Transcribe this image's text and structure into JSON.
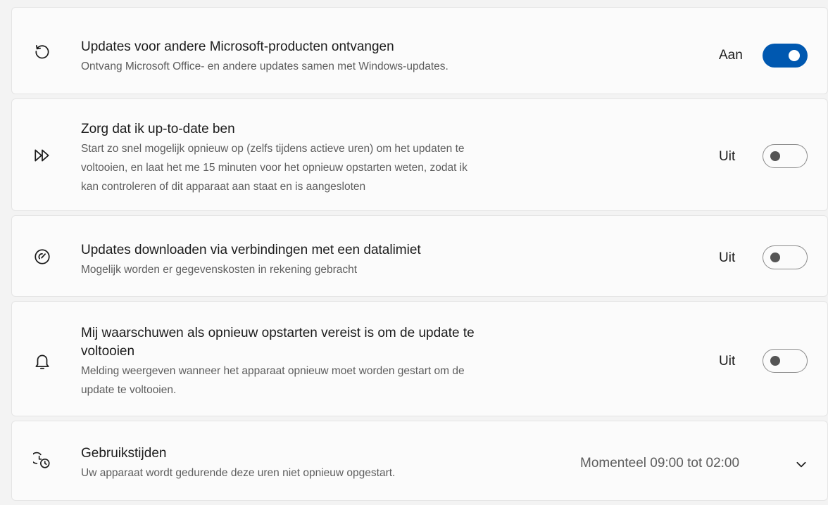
{
  "settings": [
    {
      "icon": "refresh-icon",
      "title": "Updates voor andere Microsoft-producten ontvangen",
      "description": [
        "Ontvang Microsoft Office- en andere updates samen met Windows-updates."
      ],
      "state_label": "Aan",
      "enabled": true
    },
    {
      "icon": "fast-forward-icon",
      "title": "Zorg dat ik up-to-date ben",
      "description": [
        "Start zo snel mogelijk opnieuw op (zelfs tijdens actieve uren) om het updaten te",
        "voltooien, en laat het me 15 minuten voor het opnieuw opstarten weten, zodat ik",
        "kan controleren of dit apparaat aan staat en is aangesloten"
      ],
      "state_label": "Uit",
      "enabled": false
    },
    {
      "icon": "speedometer-icon",
      "title": "Updates downloaden via verbindingen met een datalimiet",
      "description": [
        "Mogelijk worden er gegevenskosten in rekening gebracht"
      ],
      "state_label": "Uit",
      "enabled": false
    },
    {
      "icon": "bell-icon",
      "title": [
        "Mij waarschuwen als opnieuw opstarten vereist is om de update te",
        "voltooien"
      ],
      "description": [
        "Melding weergeven wanneer het apparaat opnieuw moet worden gestart om de",
        "update te voltooien."
      ],
      "state_label": "Uit",
      "enabled": false
    },
    {
      "icon": "active-hours-icon",
      "title": "Gebruikstijden",
      "description": [
        "Uw apparaat wordt gedurende deze uren niet opnieuw opgestart."
      ],
      "value": "Momenteel 09:00 tot 02:00",
      "expander_icon": "chevron-down-icon"
    }
  ]
}
